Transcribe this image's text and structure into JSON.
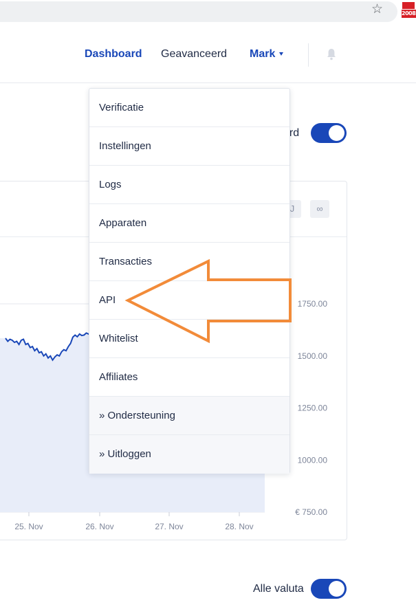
{
  "browser": {
    "star_icon": "star-outline-icon",
    "extension_badge": "2008"
  },
  "nav": {
    "dashboard": "Dashboard",
    "advanced": "Geavanceerd",
    "user": "Mark",
    "notifications_icon": "bell-icon"
  },
  "toggles": {
    "top_label_partial": "erd",
    "bottom_label": "Alle valuta"
  },
  "chart_card": {
    "range_buttons": [
      "J",
      "∞"
    ]
  },
  "chart_data": {
    "type": "area",
    "x_labels": [
      "25. Nov",
      "26. Nov",
      "27. Nov",
      "28. Nov"
    ],
    "y_labels": [
      "1750.00",
      "1500.00",
      "1250.00",
      "1000.00",
      "€ 750.00"
    ],
    "y_ticks": [
      1750,
      1500,
      1250,
      1000,
      750
    ],
    "ylim": [
      750,
      1750
    ],
    "series_color": "#1947b8",
    "fill_color": "#e8edf9",
    "grid": true,
    "visible_series": [
      1585,
      1570,
      1580,
      1575,
      1565,
      1570,
      1555,
      1575,
      1580,
      1555,
      1560,
      1540,
      1545,
      1525,
      1535,
      1515,
      1520,
      1500,
      1510,
      1490,
      1500,
      1480,
      1495,
      1505,
      1500,
      1520,
      1530,
      1525,
      1545,
      1560,
      1590,
      1600,
      1592,
      1605,
      1598,
      1600,
      1610,
      1605,
      1600
    ]
  },
  "dropdown": {
    "items": [
      {
        "label": "Verificatie"
      },
      {
        "label": "Instellingen"
      },
      {
        "label": "Logs"
      },
      {
        "label": "Apparaten"
      },
      {
        "label": "Transacties"
      },
      {
        "label": "API"
      },
      {
        "label": "Whitelist"
      },
      {
        "label": "Affiliates"
      },
      {
        "label": "» Ondersteuning"
      },
      {
        "label": "» Uitloggen"
      }
    ]
  },
  "annotation": {
    "arrow_color": "#f28b39",
    "points_to": "API"
  }
}
